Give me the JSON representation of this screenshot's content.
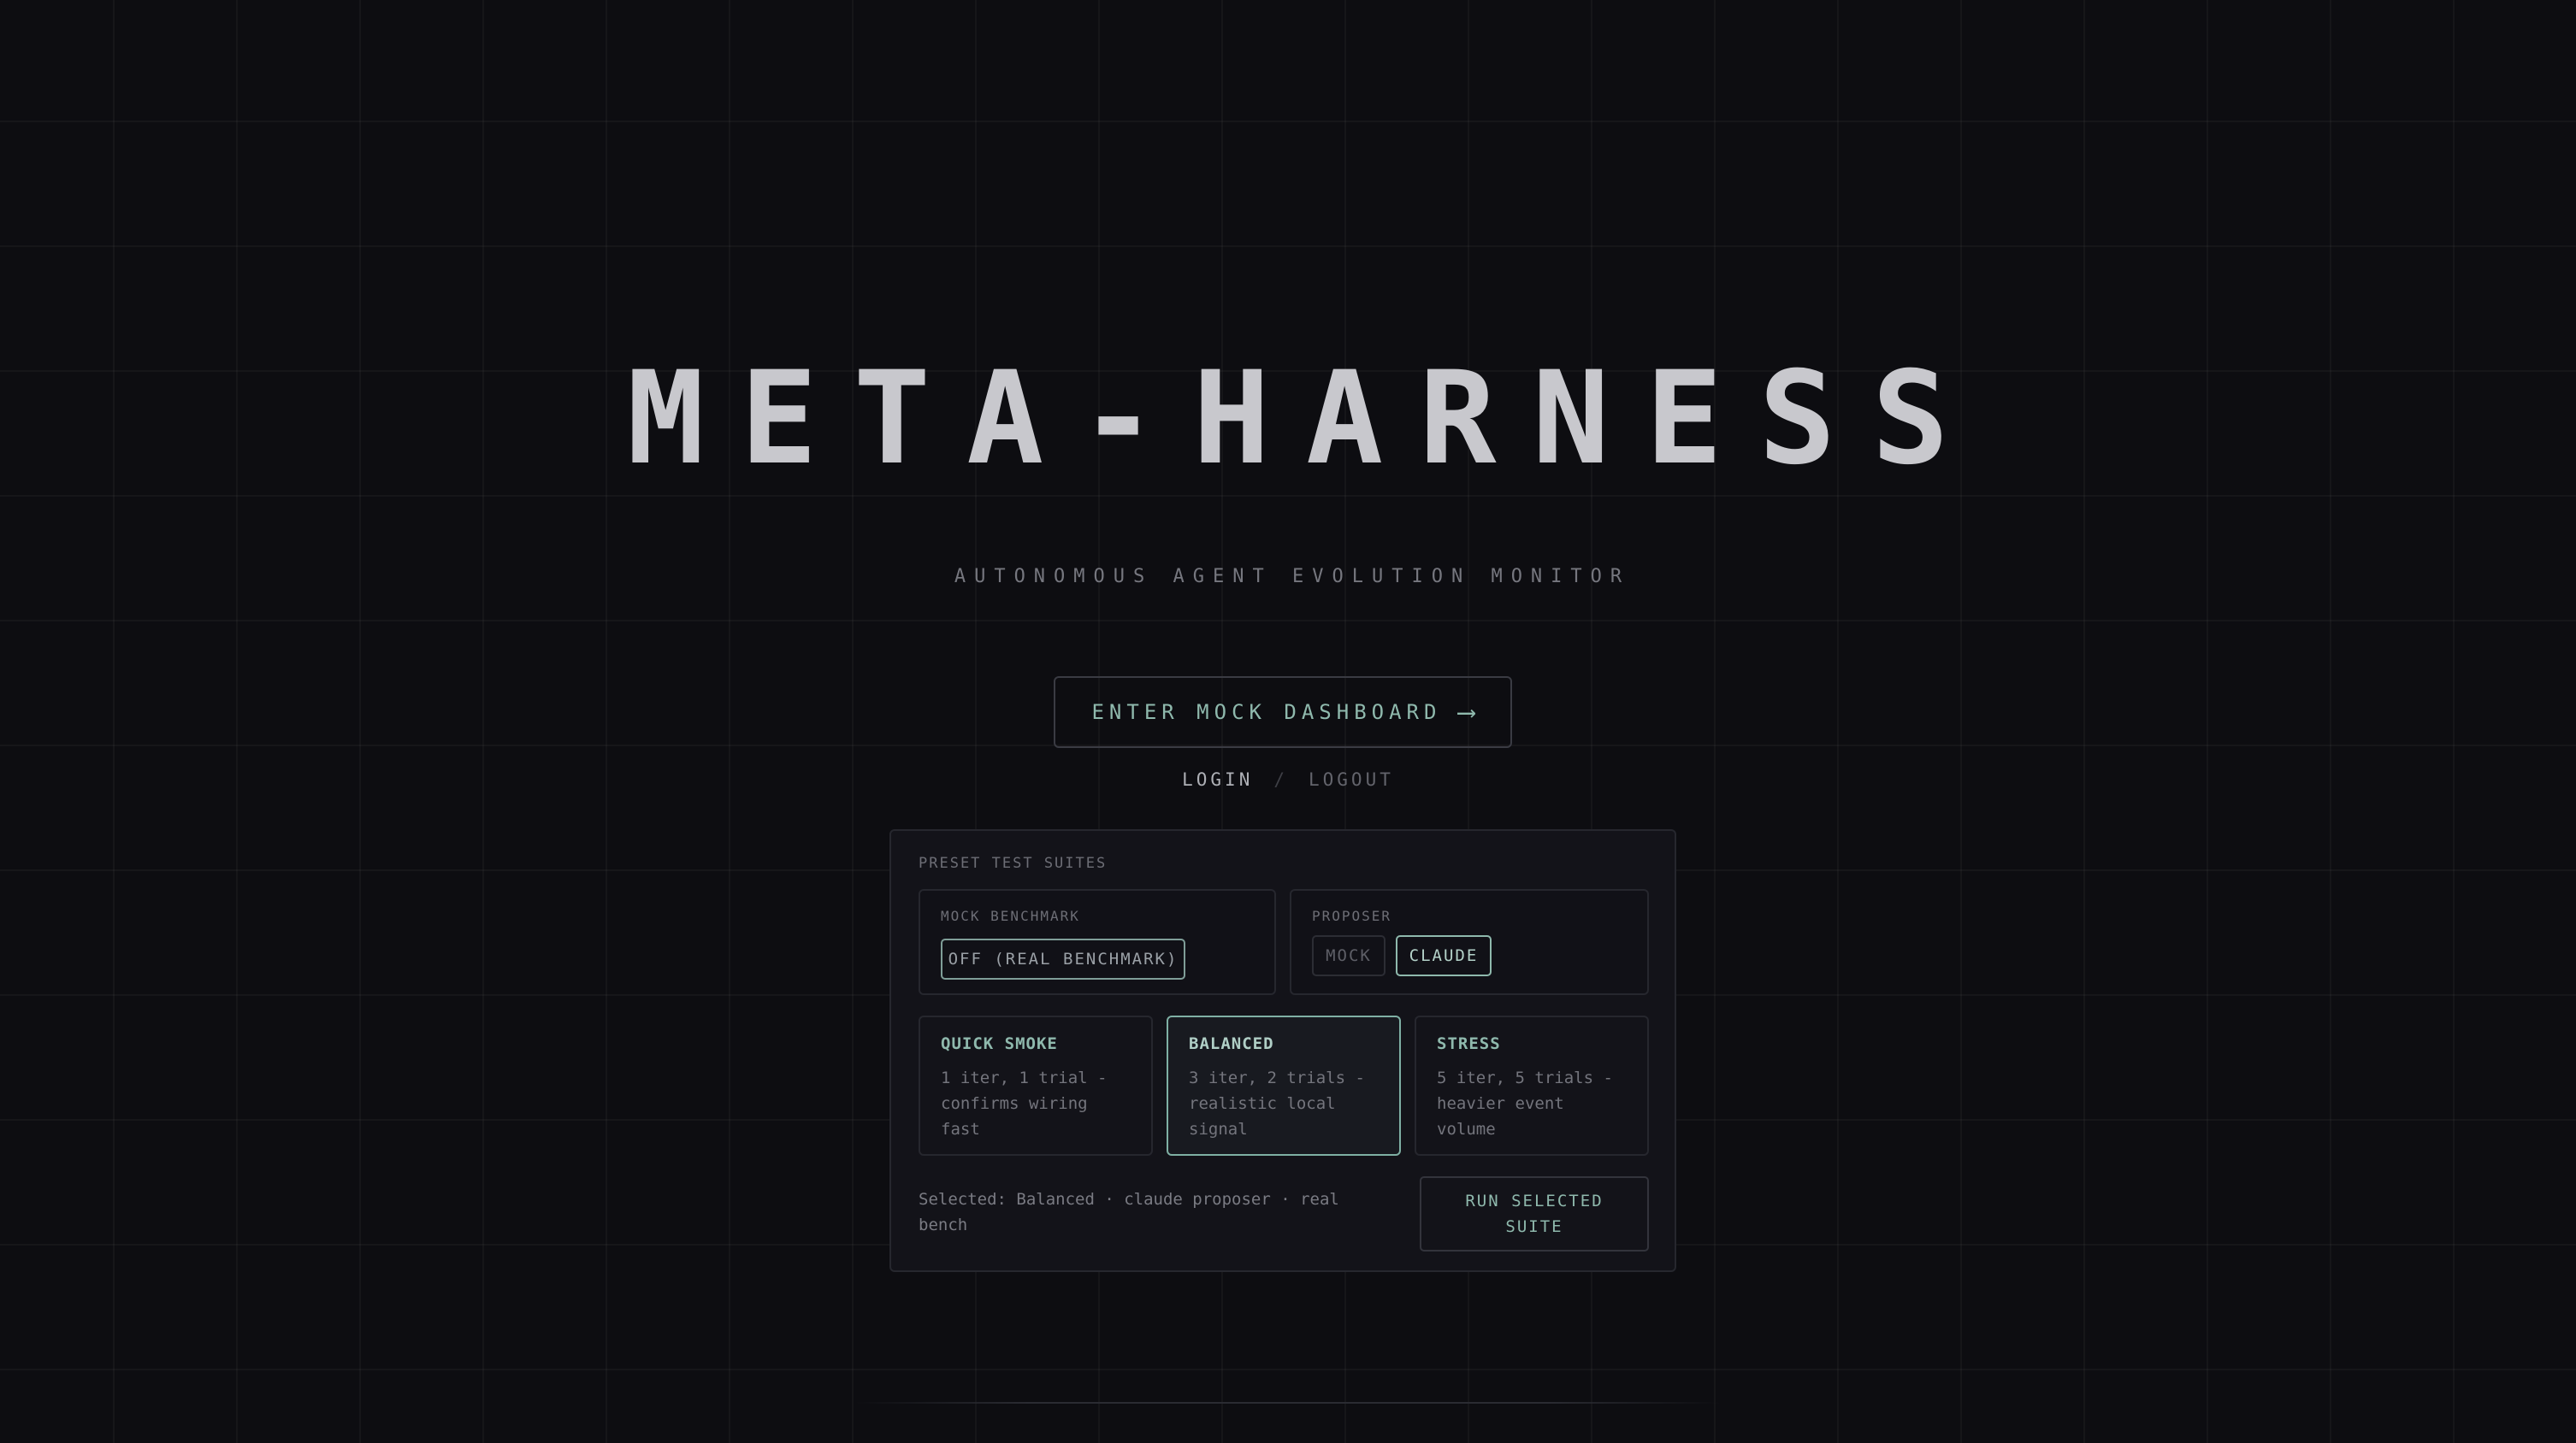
{
  "header": {
    "title": "META-HARNESS",
    "subtitle": "AUTONOMOUS AGENT EVOLUTION MONITOR"
  },
  "actions": {
    "enter_label": "ENTER MOCK DASHBOARD",
    "enter_icon": "arrow-right-icon",
    "enter_arrow": "⟶",
    "login_label": "LOGIN",
    "separator": "/",
    "logout_label": "LOGOUT"
  },
  "panel": {
    "title": "PRESET TEST SUITES",
    "mock_benchmark": {
      "label": "MOCK BENCHMARK",
      "value": "OFF (REAL BENCHMARK)"
    },
    "proposer": {
      "label": "PROPOSER",
      "options": [
        "MOCK",
        "CLAUDE"
      ],
      "selected": "CLAUDE"
    },
    "suites": [
      {
        "name": "QUICK SMOKE",
        "description": "1 iter, 1 trial - confirms wiring fast"
      },
      {
        "name": "BALANCED",
        "description": "3 iter, 2 trials - realistic local signal"
      },
      {
        "name": "STRESS",
        "description": "5 iter, 5 trials - heavier event volume"
      }
    ],
    "selected_suite": "BALANCED",
    "selection_summary": "Selected: Balanced · claude proposer · real bench",
    "run_label": "RUN SELECTED SUITE"
  },
  "colors": {
    "background": "#0d0d11",
    "accent": "#8fb9ad",
    "panel": "#131319"
  }
}
